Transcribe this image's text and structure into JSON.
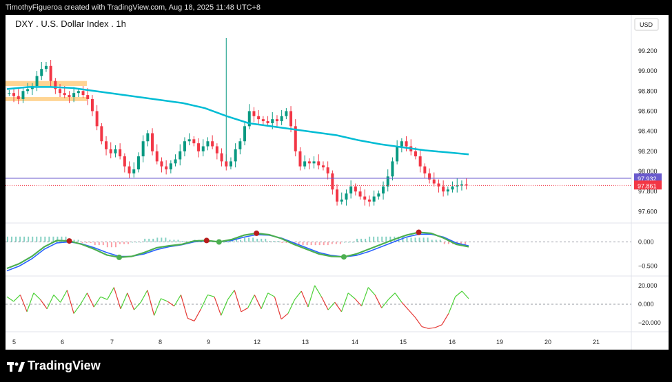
{
  "header": {
    "attribution": "TimothyFigueroa created with TradingView.com, Aug 18, 2025 11:48 UTC+8"
  },
  "footer": {
    "brand": "TradingView"
  },
  "chart_data": {
    "type": "candlestick",
    "title": "DXY . U.S. Dollar Index . 1h",
    "currency": "USD",
    "colors": {
      "up": "#089981",
      "down": "#f23645",
      "ma": "#00bcd4",
      "zone": "#ffcc80",
      "last": "#f23645",
      "ref": "#6a5acd",
      "osc_up": "#22ab94",
      "osc_down": "#f7525f",
      "fast": "#4caf50",
      "slow": "#2962ff",
      "slow_dn": "#b71c1c",
      "rsi_up": "#4cd137",
      "rsi_dn": "#e53935"
    },
    "price_axis": {
      "ylim": [
        97.5,
        99.35
      ],
      "ticks": [
        "99.200",
        "99.000",
        "98.800",
        "98.600",
        "98.400",
        "98.200",
        "98.000",
        "97.800",
        "97.600"
      ]
    },
    "price_labels": {
      "ref": "97.932",
      "last": "97.861"
    },
    "x_labels": [
      "5",
      "6",
      "7",
      "8",
      "9",
      "12",
      "13",
      "14",
      "15",
      "16",
      "19",
      "20",
      "21"
    ],
    "zones": [
      [
        98.85,
        98.9
      ],
      [
        98.7,
        98.74
      ]
    ],
    "price_path": [
      98.78,
      98.75,
      98.72,
      98.8,
      98.82,
      98.85,
      98.95,
      99.02,
      99.05,
      98.9,
      98.82,
      98.78,
      98.76,
      98.74,
      98.78,
      98.8,
      98.76,
      98.72,
      98.6,
      98.45,
      98.3,
      98.22,
      98.18,
      98.22,
      98.15,
      98.05,
      97.98,
      98.02,
      98.15,
      98.3,
      98.38,
      98.2,
      98.1,
      98.05,
      98.02,
      98.08,
      98.12,
      98.2,
      98.3,
      98.32,
      98.28,
      98.2,
      98.25,
      98.3,
      98.25,
      98.18,
      98.1,
      98.05,
      98.1,
      98.22,
      98.3,
      98.45,
      98.6,
      98.55,
      98.52,
      98.5,
      98.48,
      98.52,
      98.5,
      98.55,
      98.6,
      98.45,
      98.2,
      98.05,
      98.1,
      98.08,
      98.1,
      98.06,
      98.04,
      97.98,
      97.82,
      97.7,
      97.72,
      97.78,
      97.85,
      97.8,
      97.75,
      97.72,
      97.7,
      97.75,
      97.78,
      97.85,
      97.95,
      98.1,
      98.25,
      98.3,
      98.25,
      98.2,
      98.15,
      98.05,
      97.98,
      97.92,
      97.88,
      97.85,
      97.8,
      97.82,
      97.85,
      97.86,
      97.87,
      97.86
    ],
    "ma_path": [
      98.82,
      98.84,
      98.84,
      98.83,
      98.8,
      98.77,
      98.74,
      98.71,
      98.68,
      98.63,
      98.55,
      98.48,
      98.45,
      98.42,
      98.39,
      98.36,
      98.31,
      98.27,
      98.24,
      98.21,
      98.19,
      98.17
    ],
    "osc": {
      "zero_label": "0.000",
      "minus_label": "−0.500",
      "ylim": [
        -0.65,
        0.35
      ],
      "fast": [
        -0.55,
        -0.45,
        -0.3,
        -0.1,
        0.03,
        0.02,
        -0.05,
        -0.15,
        -0.27,
        -0.32,
        -0.3,
        -0.22,
        -0.12,
        -0.08,
        -0.05,
        0.02,
        0.03,
        0.0,
        0.05,
        0.14,
        0.18,
        0.15,
        0.07,
        -0.05,
        -0.15,
        -0.25,
        -0.3,
        -0.31,
        -0.25,
        -0.15,
        -0.05,
        0.05,
        0.14,
        0.2,
        0.18,
        0.08,
        -0.05,
        -0.1
      ],
      "slow": [
        -0.6,
        -0.5,
        -0.35,
        -0.15,
        -0.02,
        0.0,
        -0.04,
        -0.12,
        -0.22,
        -0.3,
        -0.3,
        -0.25,
        -0.16,
        -0.1,
        -0.06,
        0.0,
        0.02,
        0.0,
        0.03,
        0.1,
        0.15,
        0.14,
        0.08,
        -0.02,
        -0.12,
        -0.22,
        -0.28,
        -0.31,
        -0.28,
        -0.2,
        -0.1,
        0.0,
        0.1,
        0.16,
        0.16,
        0.1,
        -0.02,
        -0.08
      ],
      "dots": [
        [
          5,
          "dn"
        ],
        [
          9,
          "up"
        ],
        [
          16,
          "dn"
        ],
        [
          17,
          "up"
        ],
        [
          20,
          "dn"
        ],
        [
          27,
          "up"
        ],
        [
          33,
          "dn"
        ]
      ]
    },
    "rsi": {
      "labels": [
        "20.000",
        "0.000",
        "−20.000"
      ],
      "ylim": [
        -28,
        28
      ],
      "values": [
        8,
        3,
        10,
        -8,
        12,
        5,
        -5,
        10,
        2,
        15,
        -10,
        0,
        12,
        -3,
        8,
        5,
        18,
        -5,
        12,
        -6,
        2,
        15,
        -12,
        6,
        3,
        -2,
        10,
        -15,
        -18,
        -5,
        10,
        8,
        -12,
        5,
        15,
        -8,
        -4,
        10,
        -5,
        12,
        8,
        -16,
        -10,
        5,
        14,
        -3,
        20,
        8,
        -6,
        2,
        -8,
        12,
        6,
        -2,
        18,
        10,
        -4,
        5,
        12,
        2,
        -6,
        -14,
        -24,
        -26,
        -25,
        -22,
        -10,
        8,
        14,
        6
      ]
    }
  }
}
